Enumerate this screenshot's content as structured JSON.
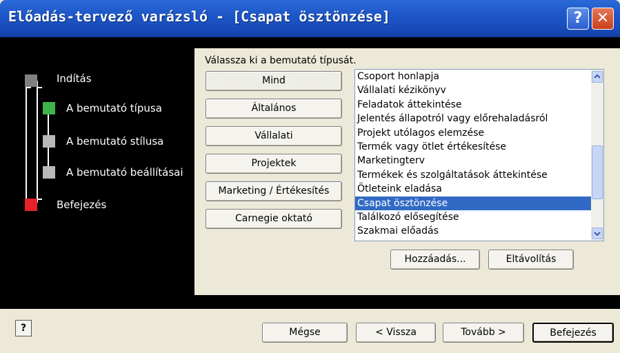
{
  "window": {
    "title": "Előadás-tervező varázsló - [Csapat ösztönzése]"
  },
  "titlebar_buttons": {
    "help": "?",
    "close": "✕"
  },
  "steps": [
    {
      "label": "Indítás",
      "color": "#808080"
    },
    {
      "label": "A bemutató típusa",
      "color": "#3fb44a"
    },
    {
      "label": "A bemutató stílusa",
      "color": "#b8b8b8"
    },
    {
      "label": "A bemutató beállításai",
      "color": "#b8b8b8"
    },
    {
      "label": "Befejezés",
      "color": "#e8202a"
    }
  ],
  "main": {
    "prompt": "Válassza ki a bemutató típusát.",
    "categories": [
      "Mind",
      "Általános",
      "Vállalati",
      "Projektek",
      "Marketing / Értékesítés",
      "Carnegie oktató"
    ],
    "selected_category": "Mind",
    "list_items": [
      "Csoport honlapja",
      "Vállalati kézikönyv",
      "Feladatok áttekintése",
      "Jelentés állapotról vagy előrehaladásról",
      "Projekt utólagos elemzése",
      "Termék vagy ötlet értékesítése",
      "Marketingterv",
      "Termékek és szolgáltatások áttekintése",
      "Ötleteink eladása",
      "Csapat ösztönzése",
      "Találkozó elősegítése",
      "Szakmai előadás"
    ],
    "selected_item": "Csapat ösztönzése",
    "add_label": "Hozzáadás...",
    "remove_label": "Eltávolítás"
  },
  "footer": {
    "help_icon": "?",
    "cancel_label": "Mégse",
    "back_label": "< Vissza",
    "next_label": "Tovább >",
    "finish_label": "Befejezés"
  }
}
